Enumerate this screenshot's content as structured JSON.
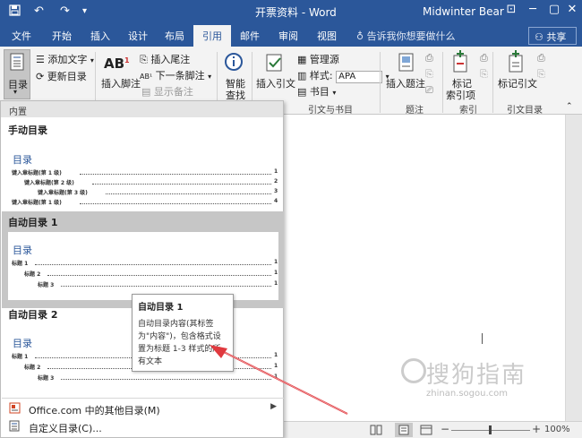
{
  "window": {
    "doc_title": "开票资料 - Word",
    "user_name": "Midwinter Bear",
    "qa_undo": "↶",
    "qa_redo": "↷",
    "qa_more": "▾",
    "minimize": "─",
    "restore": "▢",
    "close": "✕",
    "ribbon_toggle": "⊡"
  },
  "tabs": [
    "文件",
    "开始",
    "插入",
    "设计",
    "布局",
    "引用",
    "邮件",
    "审阅",
    "视图"
  ],
  "tell_me": "告诉我你想要做什么",
  "share_label": "共享",
  "ribbon": {
    "toc_button": "目录",
    "add_text": "添加文字",
    "update_toc": "更新目录",
    "insert_footnote": "插入脚注",
    "insert_endnote": "插入尾注",
    "next_footnote": "下一条脚注",
    "show_notes": "显示备注",
    "smart_lookup_1": "智能",
    "smart_lookup_2": "查找",
    "insert_citation": "插入引文",
    "manage_sources": "管理源",
    "style_label": "样式:",
    "style_value": "APA",
    "bibliography": "书目",
    "group_citations": "引文与书目",
    "insert_caption": "插入题注",
    "group_captions": "题注",
    "mark_entry_1": "标记",
    "mark_entry_2": "索引项",
    "group_index": "索引",
    "mark_citation": "标记引文",
    "group_toa": "引文目录"
  },
  "panel": {
    "header": "内置",
    "manual_title": "手动目录",
    "manual_preview": {
      "heading": "目录",
      "lines": [
        {
          "text": "键入章标题(第 1 级)",
          "num": "1"
        },
        {
          "text": "键入章标题(第 2 级)",
          "num": "2"
        },
        {
          "text": "键入章标题(第 3 级)",
          "num": "3"
        },
        {
          "text": "键入章标题(第 1 级)",
          "num": "4"
        }
      ]
    },
    "auto1_title": "自动目录 1",
    "auto1_preview": {
      "heading": "目录",
      "lines": [
        {
          "text": "标题 1",
          "num": "1"
        },
        {
          "text": "标题 2",
          "num": "1"
        },
        {
          "text": "标题 3",
          "num": "1"
        }
      ]
    },
    "auto2_title": "自动目录 2",
    "auto2_preview": {
      "heading": "目录",
      "lines": [
        {
          "text": "标题 1",
          "num": "1"
        },
        {
          "text": "标题 2",
          "num": "1"
        },
        {
          "text": "标题 3",
          "num": "1"
        }
      ]
    },
    "menu_office": "Office.com 中的其他目录(M)",
    "menu_custom": "自定义目录(C)..."
  },
  "tooltip": {
    "title": "自动目录 1",
    "body": "自动目录内容(其标签为\"内容\")，包含格式设置为标题 1-3 样式的所有文本"
  },
  "status": {
    "zoom": "100%",
    "zoom_minus": "−",
    "zoom_plus": "+"
  },
  "watermark": {
    "cn": "搜狗指南",
    "en": "zhinan.sogou.com"
  },
  "colors": {
    "accent": "#2b579a",
    "annotation_arrow": "#e0393e"
  }
}
